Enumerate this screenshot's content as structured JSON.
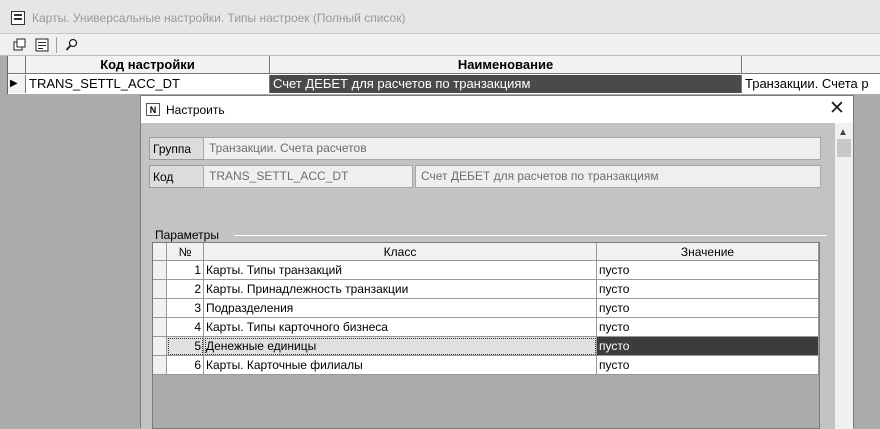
{
  "window": {
    "title": "Карты. Универсальные настройки. Типы настроек (Полный список)",
    "toolbar": [
      {
        "icon": "copy-icon"
      },
      {
        "icon": "form-icon"
      },
      {
        "icon": "search-icon"
      }
    ]
  },
  "main_grid": {
    "columns": [
      "Код настройки",
      "Наименование",
      ""
    ],
    "rows": [
      {
        "indicator": "▶",
        "code": "TRANS_SETTL_ACC_DT",
        "name": "Счет ДЕБЕТ для расчетов по транзакциям",
        "group": "Транзакции. Счета р"
      }
    ]
  },
  "dialog": {
    "title": "Настроить",
    "title_icon": "N",
    "close": "✕",
    "group_label": "Группа",
    "group_value": "Транзакции. Счета расчетов",
    "code_label": "Код",
    "code_value": "TRANS_SETTL_ACC_DT",
    "code_name": "Счет ДЕБЕТ для расчетов по транзакциям",
    "params_label": "Параметры",
    "params_columns": [
      "№",
      "Класс",
      "Значение"
    ],
    "params_rows": [
      {
        "num": "1",
        "class": "Карты. Типы транзакций",
        "value": "пусто"
      },
      {
        "num": "2",
        "class": "Карты. Принадлежность транзакции",
        "value": "пусто"
      },
      {
        "num": "3",
        "class": "Подразделения",
        "value": "пусто"
      },
      {
        "num": "4",
        "class": "Карты. Типы карточного бизнеса",
        "value": "пусто"
      },
      {
        "num": "5",
        "class": "Денежные единицы",
        "value": "пусто"
      },
      {
        "num": "6",
        "class": "Карты. Карточные филиалы",
        "value": "пусто"
      }
    ],
    "selected_row": 5
  },
  "colors": {
    "selection_dark": "#3c3c3c",
    "dialog_body": "#c3c3c3",
    "background": "#ababab"
  }
}
